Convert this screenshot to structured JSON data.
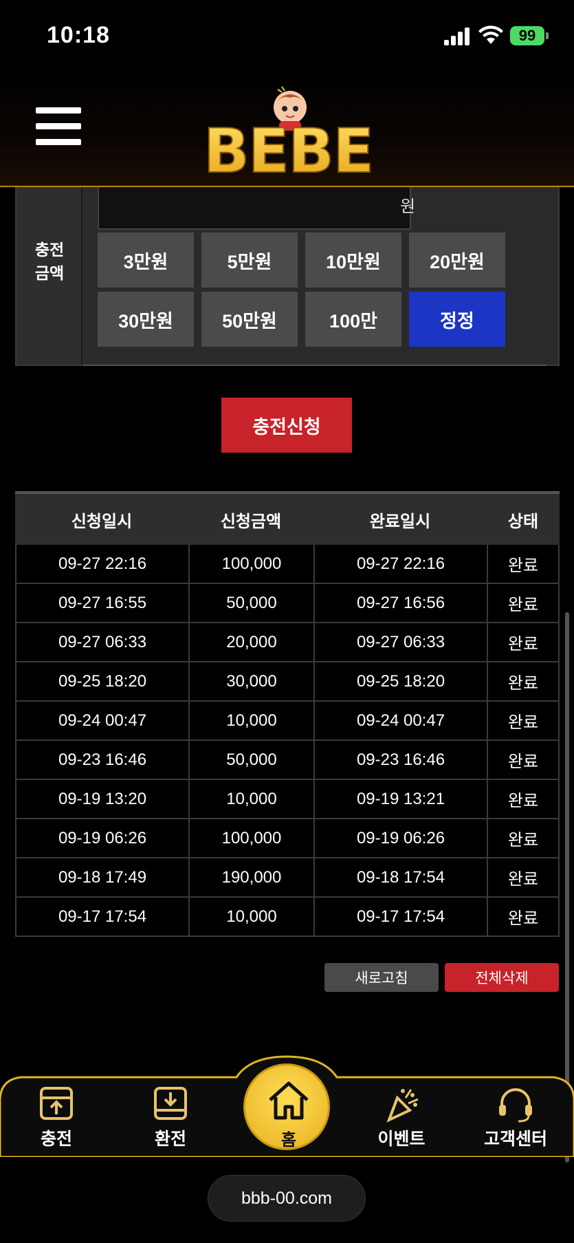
{
  "status_bar": {
    "time": "10:18",
    "battery": "99"
  },
  "header": {
    "logo_text": "BEBE"
  },
  "charge_form": {
    "label_line1": "충전",
    "label_line2": "금액",
    "input_value": "",
    "unit": "원",
    "amount_buttons": [
      "3만원",
      "5만원",
      "10만원",
      "20만원",
      "30만원",
      "50만원",
      "100만",
      "정정"
    ]
  },
  "apply_button": "충전신청",
  "history": {
    "headers": [
      "신청일시",
      "신청금액",
      "완료일시",
      "상태"
    ],
    "rows": [
      [
        "09-27 22:16",
        "100,000",
        "09-27 22:16",
        "완료"
      ],
      [
        "09-27 16:55",
        "50,000",
        "09-27 16:56",
        "완료"
      ],
      [
        "09-27 06:33",
        "20,000",
        "09-27 06:33",
        "완료"
      ],
      [
        "09-25 18:20",
        "30,000",
        "09-25 18:20",
        "완료"
      ],
      [
        "09-24 00:47",
        "10,000",
        "09-24 00:47",
        "완료"
      ],
      [
        "09-23 16:46",
        "50,000",
        "09-23 16:46",
        "완료"
      ],
      [
        "09-19 13:20",
        "10,000",
        "09-19 13:21",
        "완료"
      ],
      [
        "09-19 06:26",
        "100,000",
        "09-19 06:26",
        "완료"
      ],
      [
        "09-18 17:49",
        "190,000",
        "09-18 17:54",
        "완료"
      ],
      [
        "09-17 17:54",
        "10,000",
        "09-17 17:54",
        "완료"
      ]
    ]
  },
  "actions": {
    "refresh": "새로고침",
    "delete_all": "전체삭제"
  },
  "bottom_nav": {
    "charge": "충전",
    "exchange": "환전",
    "home": "홈",
    "event": "이벤트",
    "support": "고객센터"
  },
  "url": "bbb-00.com",
  "colors": {
    "accent_red": "#c8232a",
    "accent_blue": "#1c35c4",
    "gold": "#f5c832"
  }
}
